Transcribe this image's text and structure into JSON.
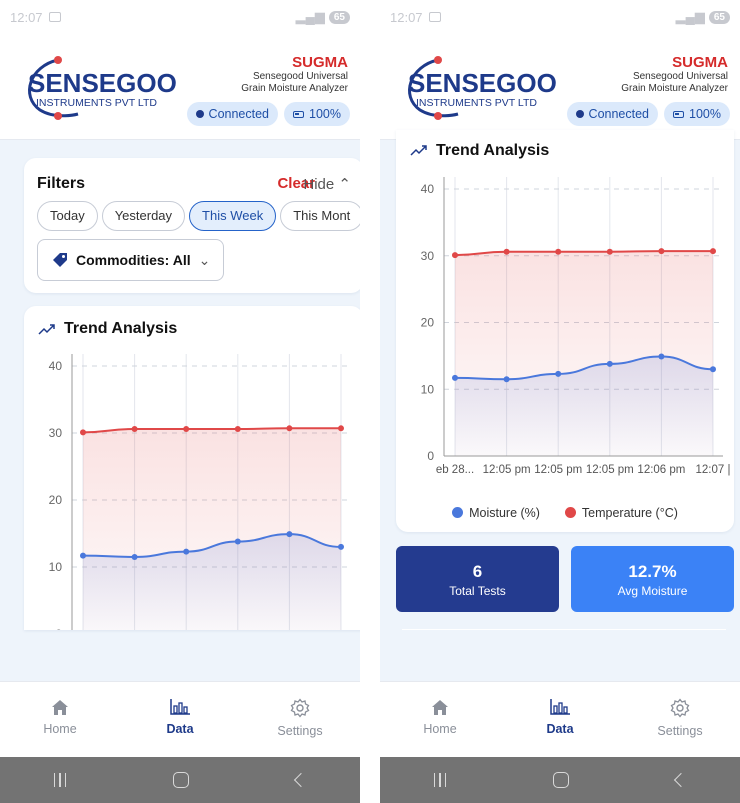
{
  "status_bar": {
    "time": "12:07",
    "battery": "65"
  },
  "header": {
    "logo_name": "SENSEGOOD",
    "logo_sub": "INSTRUMENTS PVT LTD",
    "product": "SUGMA",
    "desc_line1": "Sensegood Universal",
    "desc_line2": "Grain Moisture Analyzer",
    "connection": "Connected",
    "battery": "100%"
  },
  "filters": {
    "title": "Filters",
    "clear": "Clear",
    "hide": "Hide",
    "chips": [
      "Today",
      "Yesterday",
      "This Week",
      "This Mont"
    ],
    "active_chip": "This Week",
    "commodities": "Commodities: All"
  },
  "trend": {
    "title": "Trend Analysis"
  },
  "chart_data": {
    "type": "area",
    "title": "Trend Analysis",
    "x": [
      "eb 28...",
      "12:05 pm",
      "12:05 pm",
      "12:05 pm",
      "12:06 pm",
      "12:07 |"
    ],
    "ylim": [
      0,
      40
    ],
    "yticks": [
      0,
      10,
      20,
      30,
      40
    ],
    "grid": true,
    "legend_position": "bottom",
    "series": [
      {
        "name": "Moisture (%)",
        "color": "#4a78dc",
        "values": [
          11.7,
          11.5,
          12.3,
          13.8,
          14.9,
          13.0
        ]
      },
      {
        "name": "Temperature (°C)",
        "color": "#e04848",
        "values": [
          30.1,
          30.6,
          30.6,
          30.6,
          30.7,
          30.7
        ]
      }
    ]
  },
  "stats": [
    {
      "value": "6",
      "label": "Total Tests"
    },
    {
      "value": "12.7%",
      "label": "Avg Moisture"
    }
  ],
  "tabs": [
    {
      "label": "Home",
      "icon": "home-icon"
    },
    {
      "label": "Data",
      "icon": "bar-chart-icon"
    },
    {
      "label": "Settings",
      "icon": "gear-icon"
    }
  ],
  "active_tab": "Data"
}
